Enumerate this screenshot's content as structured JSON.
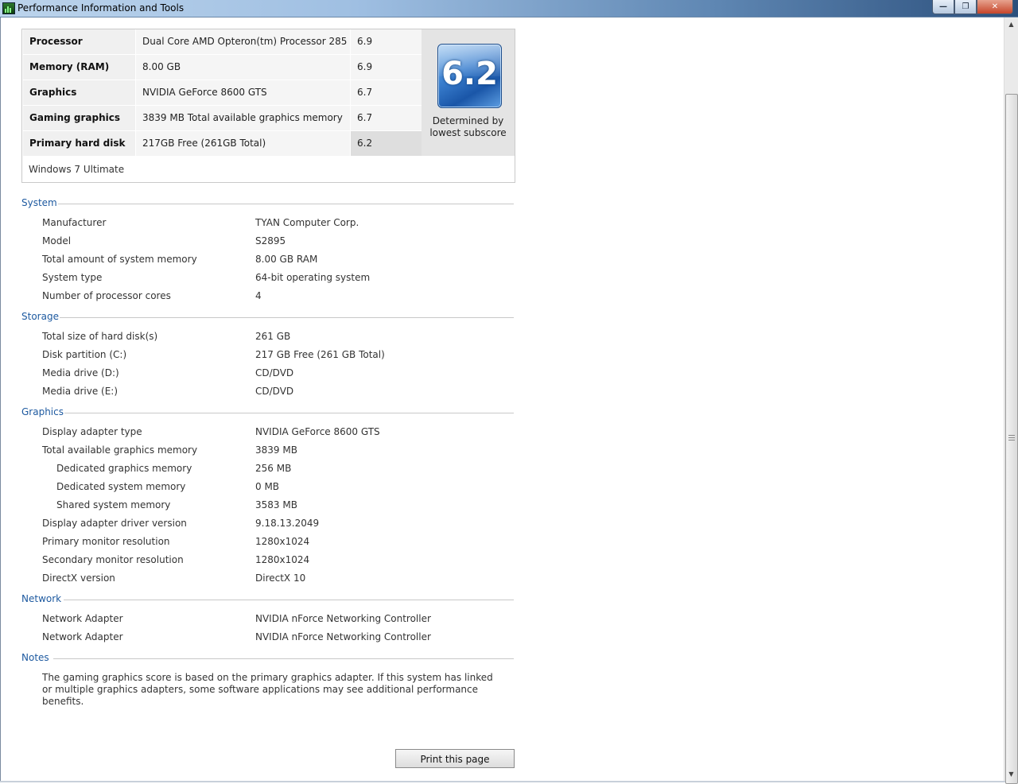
{
  "window": {
    "title": "Performance Information and Tools",
    "min_glyph": "—",
    "max_glyph": "❐",
    "close_glyph": "✕"
  },
  "scrollbar": {
    "up_glyph": "▲",
    "down_glyph": "▼"
  },
  "scores": {
    "rows": [
      {
        "component": "Processor",
        "detail": "Dual Core AMD Opteron(tm) Processor 285",
        "subscore": "6.9"
      },
      {
        "component": "Memory (RAM)",
        "detail": "8.00 GB",
        "subscore": "6.9"
      },
      {
        "component": "Graphics",
        "detail": "NVIDIA GeForce 8600 GTS",
        "subscore": "6.7"
      },
      {
        "component": "Gaming graphics",
        "detail": "3839 MB Total available graphics memory",
        "subscore": "6.7"
      },
      {
        "component": "Primary hard disk",
        "detail": "217GB Free (261GB Total)",
        "subscore": "6.2"
      }
    ],
    "base_score": "6.2",
    "base_caption_line1": "Determined by",
    "base_caption_line2": "lowest subscore",
    "edition": "Windows 7 Ultimate"
  },
  "system": {
    "heading": "System",
    "items": [
      {
        "label": "Manufacturer",
        "value": "TYAN Computer Corp."
      },
      {
        "label": "Model",
        "value": "S2895"
      },
      {
        "label": "Total amount of system memory",
        "value": "8.00 GB RAM"
      },
      {
        "label": "System type",
        "value": "64-bit operating system"
      },
      {
        "label": "Number of processor cores",
        "value": "4"
      }
    ]
  },
  "storage": {
    "heading": "Storage",
    "items": [
      {
        "label": "Total size of hard disk(s)",
        "value": "261 GB"
      },
      {
        "label": "Disk partition (C:)",
        "value": "217 GB Free (261 GB Total)"
      },
      {
        "label": "Media drive (D:)",
        "value": "CD/DVD"
      },
      {
        "label": "Media drive (E:)",
        "value": "CD/DVD"
      }
    ]
  },
  "graphics": {
    "heading": "Graphics",
    "items": [
      {
        "label": "Display adapter type",
        "value": "NVIDIA GeForce 8600 GTS"
      },
      {
        "label": "Total available graphics memory",
        "value": "3839 MB"
      },
      {
        "label": "Dedicated graphics memory",
        "value": "256 MB"
      },
      {
        "label": "Dedicated system memory",
        "value": "0 MB"
      },
      {
        "label": "Shared system memory",
        "value": "3583 MB"
      },
      {
        "label": "Display adapter driver version",
        "value": "9.18.13.2049"
      },
      {
        "label": "Primary monitor resolution",
        "value": "1280x1024"
      },
      {
        "label": "Secondary monitor resolution",
        "value": "1280x1024"
      },
      {
        "label": "DirectX version",
        "value": "DirectX 10"
      }
    ]
  },
  "network": {
    "heading": "Network",
    "items": [
      {
        "label": "Network Adapter",
        "value": "NVIDIA nForce Networking Controller"
      },
      {
        "label": "Network Adapter",
        "value": "NVIDIA nForce Networking Controller"
      }
    ]
  },
  "notes": {
    "heading": "Notes",
    "text": "The gaming graphics score is based on the primary graphics adapter. If this system has linked or multiple graphics adapters, some software applications may see additional performance benefits."
  },
  "print_label": "Print this page"
}
